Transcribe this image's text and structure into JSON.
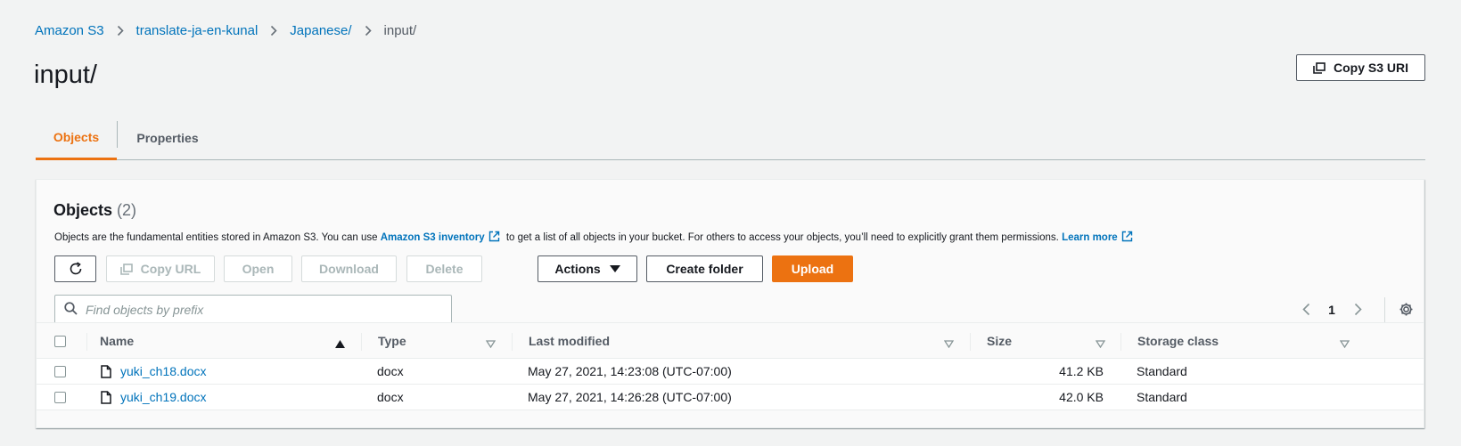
{
  "breadcrumb": {
    "items": [
      "Amazon S3",
      "translate-ja-en-kunal",
      "Japanese/"
    ],
    "current": "input/"
  },
  "page": {
    "title": "input/",
    "copy_uri_label": "Copy S3 URI"
  },
  "tabs": [
    {
      "label": "Objects",
      "active": true
    },
    {
      "label": "Properties",
      "active": false
    }
  ],
  "objects_panel": {
    "title": "Objects",
    "count": "(2)",
    "description": {
      "part1": "Objects are the fundamental entities stored in Amazon S3. You can use",
      "inventory_link": "Amazon S3 inventory",
      "part2": "to get a list of all objects in your bucket. For others to access your objects, you’ll need to explicitly grant them permissions.",
      "learn_more": "Learn more"
    },
    "toolbar": {
      "copy_url": "Copy URL",
      "open": "Open",
      "download": "Download",
      "delete": "Delete",
      "actions": "Actions",
      "create_folder": "Create folder",
      "upload": "Upload"
    },
    "search": {
      "placeholder": "Find objects by prefix",
      "value": ""
    },
    "pagination": {
      "current_page": "1"
    },
    "columns": [
      "Name",
      "Type",
      "Last modified",
      "Size",
      "Storage class"
    ],
    "rows": [
      {
        "name": "yuki_ch18.docx",
        "type": "docx",
        "last_modified": "May 27, 2021, 14:23:08 (UTC-07:00)",
        "size": "41.2 KB",
        "storage_class": "Standard"
      },
      {
        "name": "yuki_ch19.docx",
        "type": "docx",
        "last_modified": "May 27, 2021, 14:26:28 (UTC-07:00)",
        "size": "42.0 KB",
        "storage_class": "Standard"
      }
    ]
  },
  "colors": {
    "accent_orange": "#ec7211",
    "link_blue": "#0073bb",
    "background": "#f2f3f3"
  },
  "icons": [
    "chevron-right-icon",
    "copy-icon",
    "refresh-icon",
    "caret-down-icon",
    "search-icon",
    "chevron-left-icon",
    "gear-icon",
    "file-icon",
    "external-link-icon",
    "sort-asc-icon",
    "sort-icon"
  ]
}
